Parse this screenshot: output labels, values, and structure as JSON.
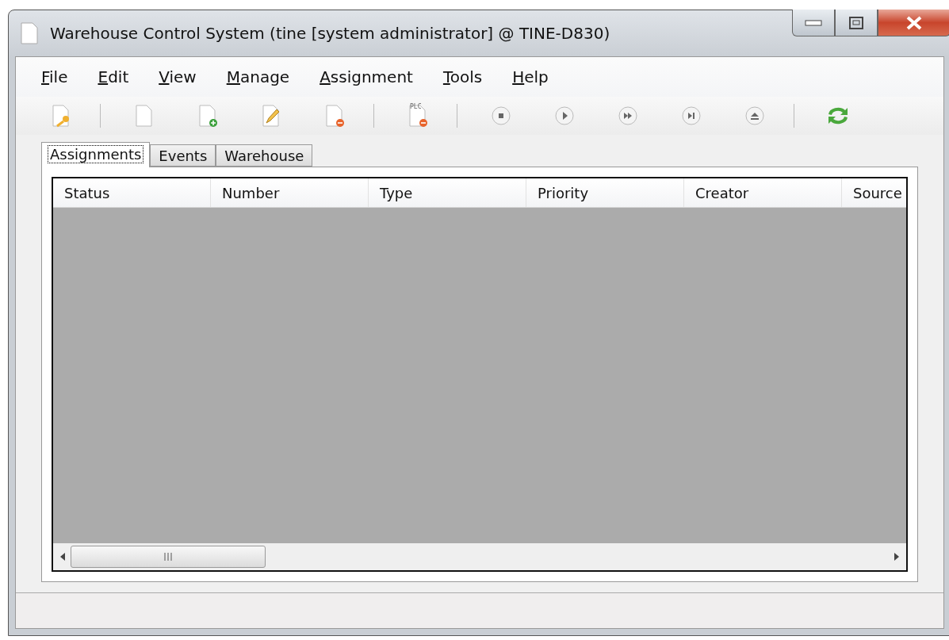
{
  "window": {
    "title": "Warehouse Control System (tine [system administrator] @ TINE-D830)"
  },
  "menu": [
    "File",
    "Edit",
    "View",
    "Manage",
    "Assignment",
    "Tools",
    "Help"
  ],
  "toolbar": [
    {
      "kind": "key-doc"
    },
    {
      "kind": "sep"
    },
    {
      "kind": "blank-doc"
    },
    {
      "kind": "add-doc"
    },
    {
      "kind": "edit-doc"
    },
    {
      "kind": "remove-doc"
    },
    {
      "kind": "sep"
    },
    {
      "kind": "plc-doc",
      "label": "PLC"
    },
    {
      "kind": "sep"
    },
    {
      "kind": "stop"
    },
    {
      "kind": "play"
    },
    {
      "kind": "fast-forward"
    },
    {
      "kind": "skip"
    },
    {
      "kind": "eject"
    },
    {
      "kind": "sep"
    },
    {
      "kind": "refresh"
    }
  ],
  "tabs": [
    {
      "label": "Assignments",
      "selected": true
    },
    {
      "label": "Events",
      "selected": false
    },
    {
      "label": "Warehouse",
      "selected": false
    }
  ],
  "table": {
    "columns": [
      "Status",
      "Number",
      "Type",
      "Priority",
      "Creator",
      "Source"
    ]
  }
}
